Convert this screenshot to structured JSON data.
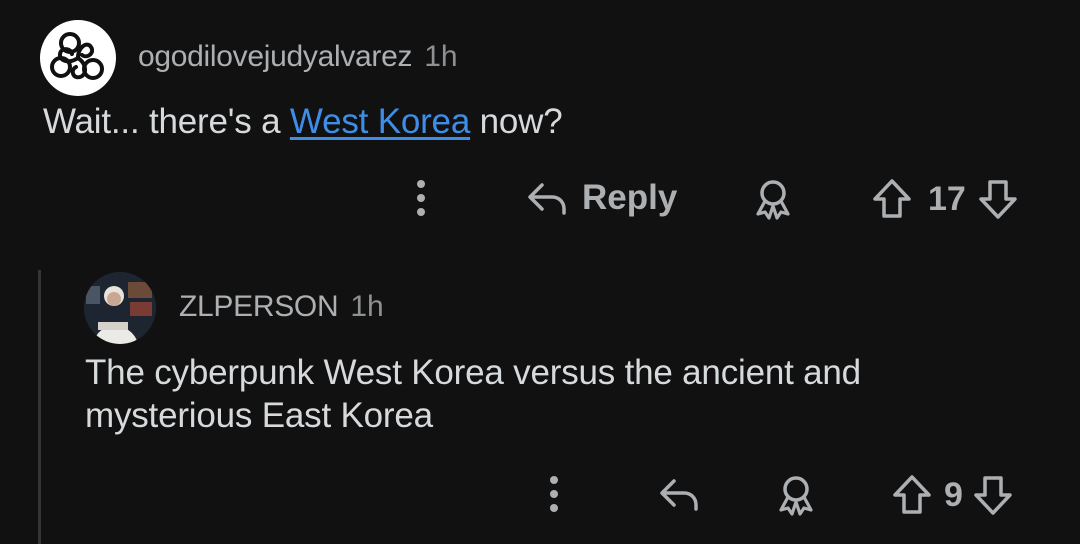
{
  "comments": [
    {
      "author": "ogodilovejudyalvarez",
      "time": "1h",
      "text_before": "Wait... there's a ",
      "link_text": "West Korea",
      "text_after": " now?",
      "reply_label": "Reply",
      "votes": "17",
      "avatar_icon": "triskelion-icon"
    },
    {
      "author": "ZLPERSON",
      "time": "1h",
      "text": "The cyberpunk West Korea versus the ancient and mysterious East Korea",
      "votes": "9",
      "avatar_icon": "user-avatar"
    }
  ],
  "colors": {
    "background": "#111111",
    "text": "#d7dadc",
    "muted": "#adb0b3",
    "link": "#3e8ee8",
    "thread_line": "#343536"
  }
}
